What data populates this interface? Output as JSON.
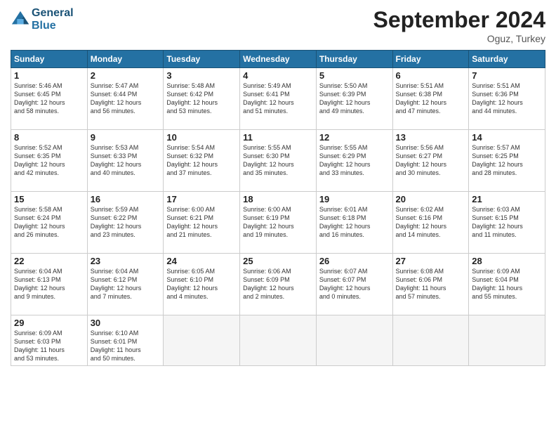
{
  "logo": {
    "line1": "General",
    "line2": "Blue"
  },
  "title": "September 2024",
  "location": "Oguz, Turkey",
  "days_of_week": [
    "Sunday",
    "Monday",
    "Tuesday",
    "Wednesday",
    "Thursday",
    "Friday",
    "Saturday"
  ],
  "weeks": [
    [
      {
        "day": "1",
        "info": "Sunrise: 5:46 AM\nSunset: 6:45 PM\nDaylight: 12 hours\nand 58 minutes."
      },
      {
        "day": "2",
        "info": "Sunrise: 5:47 AM\nSunset: 6:44 PM\nDaylight: 12 hours\nand 56 minutes."
      },
      {
        "day": "3",
        "info": "Sunrise: 5:48 AM\nSunset: 6:42 PM\nDaylight: 12 hours\nand 53 minutes."
      },
      {
        "day": "4",
        "info": "Sunrise: 5:49 AM\nSunset: 6:41 PM\nDaylight: 12 hours\nand 51 minutes."
      },
      {
        "day": "5",
        "info": "Sunrise: 5:50 AM\nSunset: 6:39 PM\nDaylight: 12 hours\nand 49 minutes."
      },
      {
        "day": "6",
        "info": "Sunrise: 5:51 AM\nSunset: 6:38 PM\nDaylight: 12 hours\nand 47 minutes."
      },
      {
        "day": "7",
        "info": "Sunrise: 5:51 AM\nSunset: 6:36 PM\nDaylight: 12 hours\nand 44 minutes."
      }
    ],
    [
      {
        "day": "8",
        "info": "Sunrise: 5:52 AM\nSunset: 6:35 PM\nDaylight: 12 hours\nand 42 minutes."
      },
      {
        "day": "9",
        "info": "Sunrise: 5:53 AM\nSunset: 6:33 PM\nDaylight: 12 hours\nand 40 minutes."
      },
      {
        "day": "10",
        "info": "Sunrise: 5:54 AM\nSunset: 6:32 PM\nDaylight: 12 hours\nand 37 minutes."
      },
      {
        "day": "11",
        "info": "Sunrise: 5:55 AM\nSunset: 6:30 PM\nDaylight: 12 hours\nand 35 minutes."
      },
      {
        "day": "12",
        "info": "Sunrise: 5:55 AM\nSunset: 6:29 PM\nDaylight: 12 hours\nand 33 minutes."
      },
      {
        "day": "13",
        "info": "Sunrise: 5:56 AM\nSunset: 6:27 PM\nDaylight: 12 hours\nand 30 minutes."
      },
      {
        "day": "14",
        "info": "Sunrise: 5:57 AM\nSunset: 6:25 PM\nDaylight: 12 hours\nand 28 minutes."
      }
    ],
    [
      {
        "day": "15",
        "info": "Sunrise: 5:58 AM\nSunset: 6:24 PM\nDaylight: 12 hours\nand 26 minutes."
      },
      {
        "day": "16",
        "info": "Sunrise: 5:59 AM\nSunset: 6:22 PM\nDaylight: 12 hours\nand 23 minutes."
      },
      {
        "day": "17",
        "info": "Sunrise: 6:00 AM\nSunset: 6:21 PM\nDaylight: 12 hours\nand 21 minutes."
      },
      {
        "day": "18",
        "info": "Sunrise: 6:00 AM\nSunset: 6:19 PM\nDaylight: 12 hours\nand 19 minutes."
      },
      {
        "day": "19",
        "info": "Sunrise: 6:01 AM\nSunset: 6:18 PM\nDaylight: 12 hours\nand 16 minutes."
      },
      {
        "day": "20",
        "info": "Sunrise: 6:02 AM\nSunset: 6:16 PM\nDaylight: 12 hours\nand 14 minutes."
      },
      {
        "day": "21",
        "info": "Sunrise: 6:03 AM\nSunset: 6:15 PM\nDaylight: 12 hours\nand 11 minutes."
      }
    ],
    [
      {
        "day": "22",
        "info": "Sunrise: 6:04 AM\nSunset: 6:13 PM\nDaylight: 12 hours\nand 9 minutes."
      },
      {
        "day": "23",
        "info": "Sunrise: 6:04 AM\nSunset: 6:12 PM\nDaylight: 12 hours\nand 7 minutes."
      },
      {
        "day": "24",
        "info": "Sunrise: 6:05 AM\nSunset: 6:10 PM\nDaylight: 12 hours\nand 4 minutes."
      },
      {
        "day": "25",
        "info": "Sunrise: 6:06 AM\nSunset: 6:09 PM\nDaylight: 12 hours\nand 2 minutes."
      },
      {
        "day": "26",
        "info": "Sunrise: 6:07 AM\nSunset: 6:07 PM\nDaylight: 12 hours\nand 0 minutes."
      },
      {
        "day": "27",
        "info": "Sunrise: 6:08 AM\nSunset: 6:06 PM\nDaylight: 11 hours\nand 57 minutes."
      },
      {
        "day": "28",
        "info": "Sunrise: 6:09 AM\nSunset: 6:04 PM\nDaylight: 11 hours\nand 55 minutes."
      }
    ],
    [
      {
        "day": "29",
        "info": "Sunrise: 6:09 AM\nSunset: 6:03 PM\nDaylight: 11 hours\nand 53 minutes."
      },
      {
        "day": "30",
        "info": "Sunrise: 6:10 AM\nSunset: 6:01 PM\nDaylight: 11 hours\nand 50 minutes."
      },
      {
        "day": "",
        "info": ""
      },
      {
        "day": "",
        "info": ""
      },
      {
        "day": "",
        "info": ""
      },
      {
        "day": "",
        "info": ""
      },
      {
        "day": "",
        "info": ""
      }
    ]
  ]
}
